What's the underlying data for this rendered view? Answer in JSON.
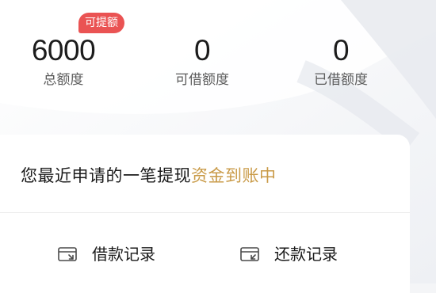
{
  "stats": {
    "total": {
      "value": "6000",
      "label": "总额度",
      "badge": "可提额"
    },
    "available": {
      "value": "0",
      "label": "可借额度"
    },
    "borrowed": {
      "value": "0",
      "label": "已借额度"
    }
  },
  "notice": {
    "prefix": "您最近申请的一笔提现",
    "highlight": "资金到账中",
    "highlight_color": "#c99a47"
  },
  "actions": [
    {
      "label": "借款记录",
      "icon": "card-in-icon"
    },
    {
      "label": "还款记录",
      "icon": "card-return-icon"
    }
  ],
  "colors": {
    "badge": "#ea5353",
    "text_primary": "#1c1c1c",
    "text_secondary": "#5b5b5b"
  }
}
